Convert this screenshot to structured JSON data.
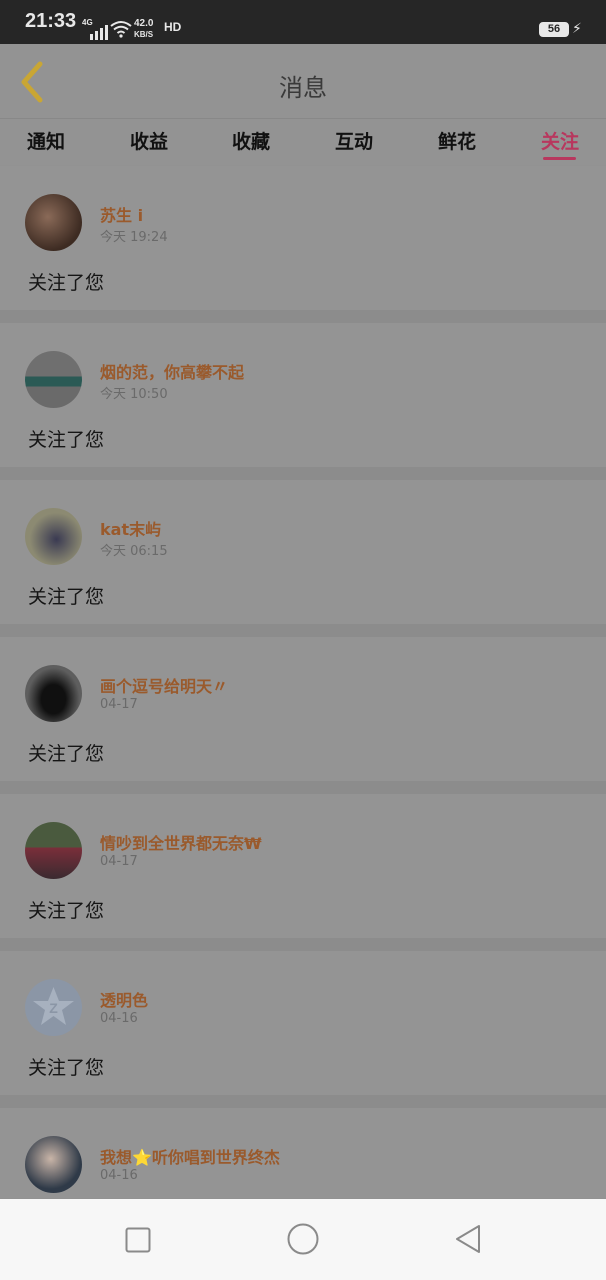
{
  "status_bar": {
    "time": "21:33",
    "network": "4G",
    "speed_value": "42.0",
    "speed_unit": "KB/S",
    "hd": "HD",
    "battery": "56"
  },
  "header": {
    "title": "消息",
    "back_icon": "chevron-left-icon"
  },
  "tabs": [
    {
      "label": "通知",
      "active": false
    },
    {
      "label": "收益",
      "active": false
    },
    {
      "label": "收藏",
      "active": false
    },
    {
      "label": "互动",
      "active": false
    },
    {
      "label": "鲜花",
      "active": false
    },
    {
      "label": "关注",
      "active": true
    }
  ],
  "feed": [
    {
      "name": "苏生 i",
      "time": "今天 19:24",
      "message": "关注了您"
    },
    {
      "name": "烟的范，你高攀不起",
      "time": "今天 10:50",
      "message": "关注了您"
    },
    {
      "name": "kat末屿",
      "time": "今天 06:15",
      "message": "关注了您"
    },
    {
      "name": "画个逗号给明天〃",
      "time": "04-17",
      "message": "关注了您"
    },
    {
      "name": "情吵到全世界都无奈₩",
      "time": "04-17",
      "message": "关注了您"
    },
    {
      "name": "透明色",
      "time": "04-16",
      "message": "关注了您"
    },
    {
      "name": "我想⭐听你唱到世界终杰",
      "time": "04-16",
      "message": ""
    }
  ],
  "colors": {
    "accent": "#b8375e",
    "name": "#9a5a2c",
    "overlay_bg": "#929292"
  },
  "nav_bar": {
    "icons": [
      "square-icon",
      "circle-icon",
      "triangle-back-icon"
    ]
  }
}
